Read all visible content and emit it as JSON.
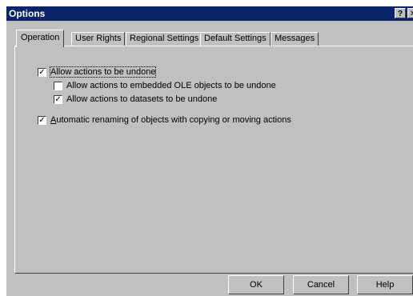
{
  "window": {
    "title": "Options",
    "help_glyph": "?",
    "close_glyph": "✕"
  },
  "tabs": [
    {
      "label": "Operation",
      "active": true
    },
    {
      "label": "User Rights",
      "active": false
    },
    {
      "label": "Regional Settings",
      "active": false
    },
    {
      "label": "Default Settings",
      "active": false
    },
    {
      "label": "Messages",
      "active": false
    }
  ],
  "options": {
    "allow_undo": {
      "label": "Allow actions to be undone",
      "checked": true
    },
    "undo_ole": {
      "label": "Allow actions to embedded OLE objects to be undone",
      "checked": false
    },
    "undo_datasets": {
      "label": "Allow actions to datasets to be undone",
      "checked": true
    },
    "auto_rename": {
      "label_first": "A",
      "label_rest": "utomatic renaming of objects with copying or moving actions",
      "checked": true
    }
  },
  "buttons": {
    "ok": "OK",
    "cancel": "Cancel",
    "help": "Help"
  },
  "colors": {
    "titlebar": "#0a246a",
    "face": "#c0c0c0"
  }
}
